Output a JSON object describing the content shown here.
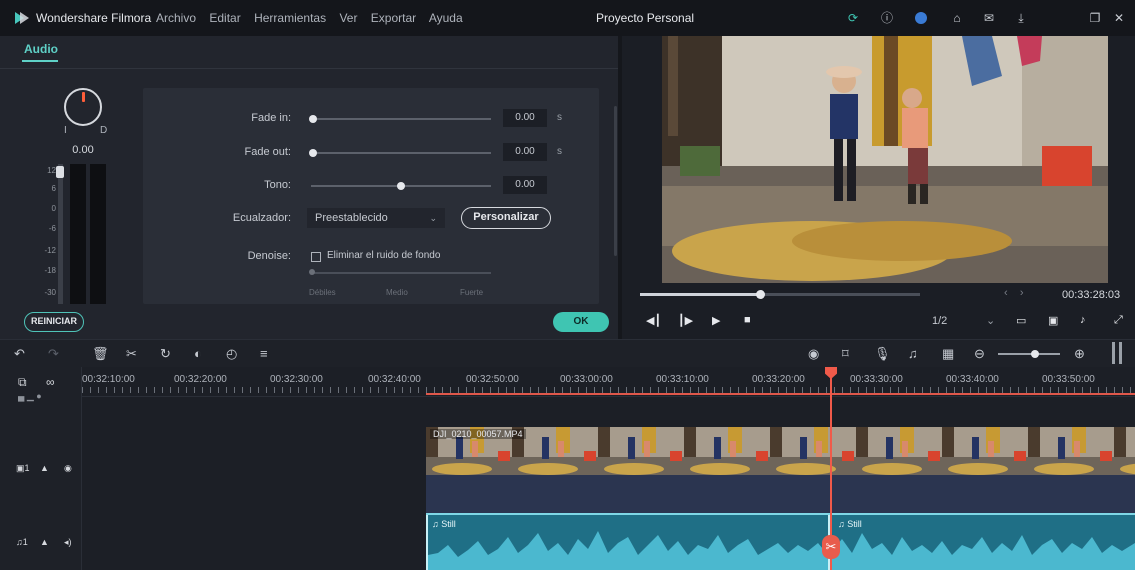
{
  "app": {
    "name": "Wondershare Filmora",
    "menu": [
      "Archivo",
      "Editar",
      "Herramientas",
      "Ver",
      "Exportar",
      "Ayuda"
    ],
    "project": "Proyecto Personal"
  },
  "audio_panel": {
    "tab": "Audio",
    "dial_left": "I",
    "dial_right": "D",
    "dial_value": "0.00",
    "db_labels": [
      "12",
      "6",
      "0",
      "-6",
      "-12",
      "-18",
      "-30"
    ],
    "fade_in_label": "Fade in:",
    "fade_in_value": "0.00",
    "fade_out_label": "Fade out:",
    "fade_out_value": "0.00",
    "unit_s": "s",
    "tone_label": "Tono:",
    "tone_value": "0.00",
    "eq_label": "Ecualzador:",
    "eq_selected": "Preestablecido",
    "customize": "Personalizar",
    "denoise_label": "Denoise:",
    "denoise_option": "Eliminar el ruido de fondo",
    "strength_low": "Débiles",
    "strength_mid": "Medio",
    "strength_high": "Fuerte",
    "reset": "REINICIAR",
    "ok": "OK"
  },
  "preview": {
    "timecode": "00:33:28:03",
    "ratio": "1/2",
    "progress": 0.43
  },
  "timeline": {
    "ticks": [
      "00:32:10:00",
      "00:32:20:00",
      "00:32:30:00",
      "00:32:40:00",
      "00:32:50:00",
      "00:33:00:00",
      "00:33:10:00",
      "00:33:20:00",
      "00:33:30:00",
      "00:33:40:00",
      "00:33:50:00"
    ],
    "video_clip": "DJI_0210_00057.MP4",
    "audio_clip_a": "Still",
    "audio_clip_b": "Still",
    "track_video": "1",
    "track_audio": "1"
  }
}
